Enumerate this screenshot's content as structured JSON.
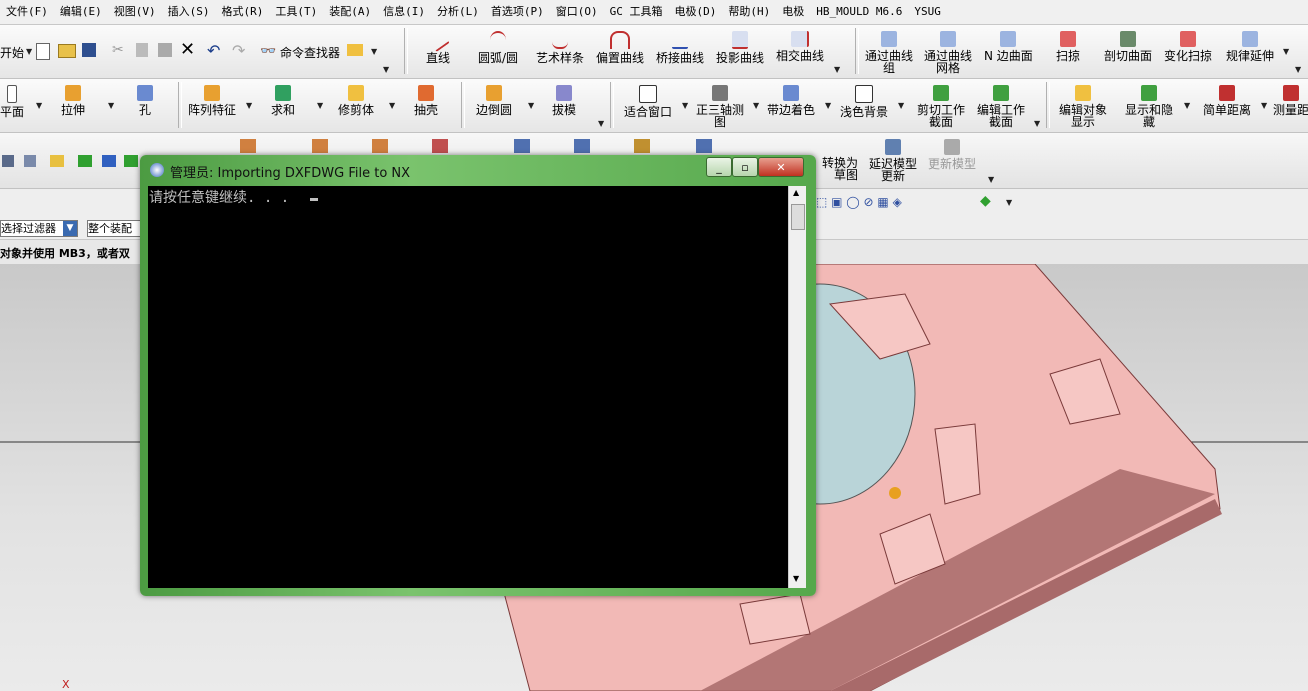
{
  "menubar": {
    "items": [
      "文件(F)",
      "编辑(E)",
      "视图(V)",
      "插入(S)",
      "格式(R)",
      "工具(T)",
      "装配(A)",
      "信息(I)",
      "分析(L)",
      "首选项(P)",
      "窗口(O)",
      "GC 工具箱",
      "电极(D)",
      "帮助(H)",
      "电极",
      "HB_MOULD M6.6",
      "YSUG"
    ]
  },
  "toolbar1": {
    "start_label": "开始",
    "command_finder": "命令查找器",
    "buttons": [
      "直线",
      "圆弧/圆",
      "艺术样条",
      "偏置曲线",
      "桥接曲线",
      "投影曲线",
      "相交曲线",
      "通过曲线组",
      "通过曲线网格",
      "N 边曲面",
      "扫掠",
      "剖切曲面",
      "变化扫掠",
      "规律延伸"
    ]
  },
  "toolbar2": {
    "buttons": [
      "平面",
      "拉伸",
      "孔",
      "阵列特征",
      "求和",
      "修剪体",
      "抽壳",
      "边倒圆",
      "拔模",
      "适合窗口",
      "正三轴测图",
      "带边着色",
      "浅色背景",
      "剪切工作截面",
      "编辑工作截面",
      "编辑对象显示",
      "显示和隐藏",
      "简单距离",
      "测量距"
    ]
  },
  "toolbar3": {
    "partial_label": "转换为草图",
    "delay_update": "延迟模型更新",
    "update_model": "更新模型"
  },
  "filterbar": {
    "filter_select": "选择过滤器",
    "scope_select": "整个装配",
    "prompt": "对象并使用 MB3，或者双"
  },
  "console": {
    "title": "管理员: Importing DXFDWG File to NX",
    "text": "请按任意键继续. . . ",
    "icons": [
      "minimize-icon",
      "maximize-icon",
      "close-icon"
    ]
  },
  "viewport": {
    "axis_label": "X"
  },
  "colors": {
    "part": "#f2b9b6",
    "part_shade": "#a86a6a",
    "console_bg": "#000000",
    "console_frame": "#6fb862"
  }
}
